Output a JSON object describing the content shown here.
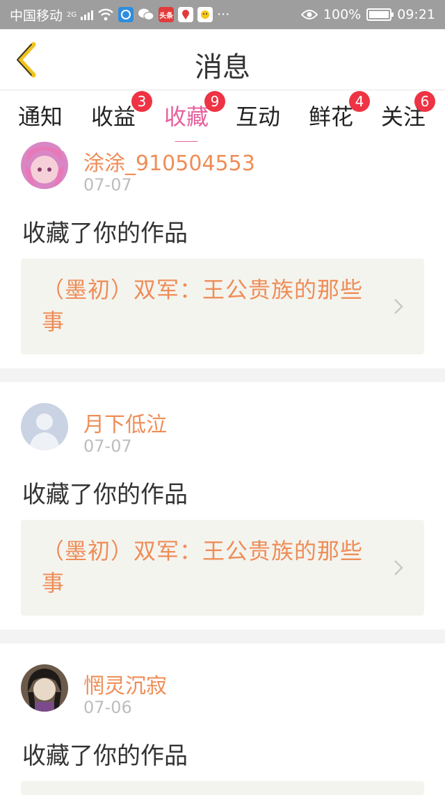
{
  "status_bar": {
    "carrier": "中国移动",
    "network": "2G",
    "battery": "100%",
    "battery_level": 1.0,
    "time": "09:21",
    "more": "···",
    "toutiao_label": "头条"
  },
  "header": {
    "title": "消息"
  },
  "tabs": [
    {
      "label": "通知",
      "badge": ""
    },
    {
      "label": "收益",
      "badge": "3"
    },
    {
      "label": "收藏",
      "badge": "9",
      "active": true
    },
    {
      "label": "互动",
      "badge": ""
    },
    {
      "label": "鲜花",
      "badge": "4"
    },
    {
      "label": "关注",
      "badge": "6"
    }
  ],
  "colors": {
    "accent": "#e6609c",
    "username": "#ef8d57",
    "badge": "#ee3344"
  },
  "items": [
    {
      "username": "涂涂_910504553",
      "date": "07-07",
      "action": "收藏了你的作品",
      "work_title": "（墨初）双军：王公贵族的那些事",
      "avatar": "anime-pink-hair-avatar"
    },
    {
      "username": "月下低泣",
      "date": "07-07",
      "action": "收藏了你的作品",
      "work_title": "（墨初）双军：王公贵族的那些事",
      "avatar": "default-user-avatar"
    },
    {
      "username": "惘灵沉寂",
      "date": "07-06",
      "action": "收藏了你的作品",
      "work_title": "",
      "avatar": "anime-dark-hair-avatar"
    }
  ]
}
